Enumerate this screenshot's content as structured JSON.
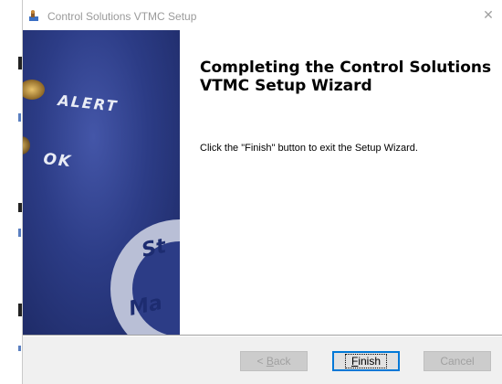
{
  "window": {
    "title": "Control Solutions VTMC Setup",
    "close_glyph": "✕",
    "app_icon": "installer-icon"
  },
  "banner": {
    "label_alert": "ALERT",
    "label_ok": "OK",
    "label_st": "St",
    "label_ma": "Ma",
    "colors": {
      "background": "#2c3c86",
      "lamp": "#c79a3a",
      "dial": "#b9bfd6"
    }
  },
  "content": {
    "heading": "Completing the Control Solutions VTMC Setup Wizard",
    "message": "Click the \"Finish\" button to exit the Setup Wizard."
  },
  "buttons": {
    "back": {
      "pre": "< ",
      "mnemonic": "B",
      "rest": "ack",
      "enabled": false
    },
    "finish": {
      "pre": "",
      "mnemonic": "F",
      "rest": "inish",
      "enabled": true,
      "default": true
    },
    "cancel": {
      "label": "Cancel",
      "enabled": false
    }
  },
  "colors": {
    "dialog_bg": "#f0f0f0",
    "focus_border": "#0078d7",
    "disabled_text": "#a0a0a0"
  }
}
